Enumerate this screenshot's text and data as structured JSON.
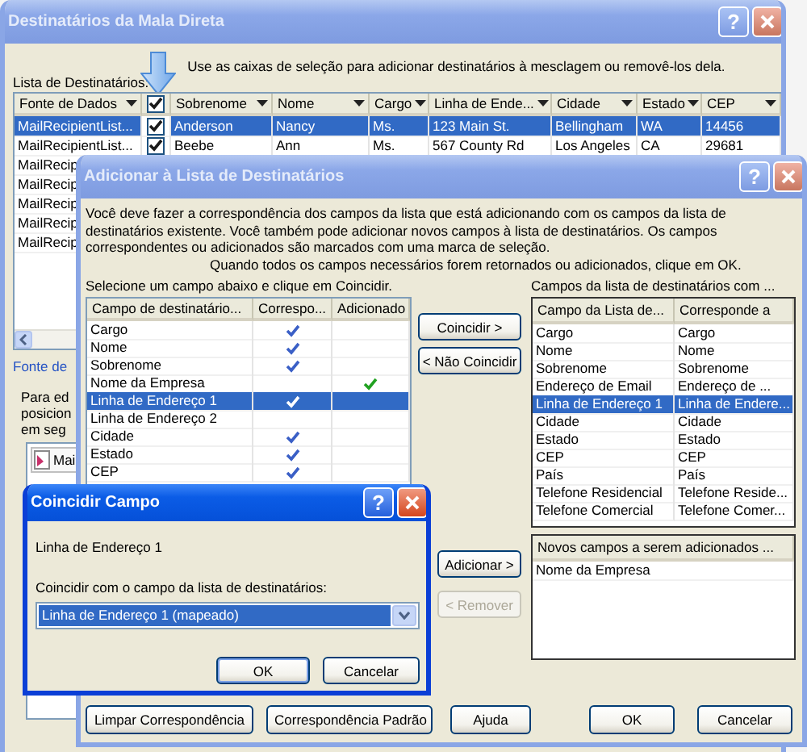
{
  "recipients_dialog": {
    "window": {
      "title": "Destinatários da Mala Direta",
      "help": "?",
      "active": false
    },
    "list_label": "Lista de Destinatários:",
    "hint": "Use as caixas de seleção para adicionar destinatários à mesclagem ou removê-los dela.",
    "table": {
      "columns": [
        "Fonte de Dados",
        "Sobrenome",
        "Nome",
        "Cargo",
        "Linha de Ende...",
        "Cidade",
        "Estado",
        "CEP"
      ],
      "header_checked": true,
      "rows": [
        {
          "source": "MailRecipientList...",
          "checked": true,
          "selected": true,
          "cells": [
            "Anderson",
            "Nancy",
            "Ms.",
            "123 Main St.",
            "Bellingham",
            "WA",
            "14456"
          ]
        },
        {
          "source": "MailRecipientList...",
          "checked": true,
          "selected": false,
          "cells": [
            "Beebe",
            "Ann",
            "Ms.",
            "567 County Rd",
            "Los Angeles",
            "CA",
            "29681"
          ]
        },
        {
          "source": "MailRecip",
          "selected": false
        },
        {
          "source": "MailRecip",
          "selected": false
        },
        {
          "source": "MailRecip",
          "selected": false
        },
        {
          "source": "MailRecip",
          "selected": false
        },
        {
          "source": "MailRecip",
          "selected": false
        }
      ]
    },
    "link": "Fonte de",
    "description_lines": [
      "Para ed",
      "posicion",
      "em seg"
    ],
    "list_item": "Mai"
  },
  "add_dialog": {
    "window": {
      "title": "Adicionar à Lista de Destinatários",
      "help": "?",
      "active": false
    },
    "intro": "Você deve fazer a correspondência dos campos da lista que está adicionando com os campos da lista de destinatários existente. Você também pode adicionar novos campos à lista de destinatários. Os campos correspondentes ou adicionados são marcados com uma marca de seleção.",
    "note": "Quando todos os campos necessários forem retornados ou adicionados, clique em OK.",
    "left_label": "Selecione um campo abaixo e clique em Coincidir.",
    "left_list": {
      "columns": [
        "Campo de destinatário...",
        "Correspo...",
        "Adicionado"
      ],
      "rows": [
        {
          "field": "Cargo",
          "matched": true,
          "added": false,
          "selected": false
        },
        {
          "field": "Nome",
          "matched": true,
          "added": false,
          "selected": false
        },
        {
          "field": "Sobrenome",
          "matched": true,
          "added": false,
          "selected": false
        },
        {
          "field": "Nome da Empresa",
          "matched": false,
          "added": true,
          "selected": false
        },
        {
          "field": "Linha de Endereço 1",
          "matched": true,
          "added": false,
          "selected": true
        },
        {
          "field": "Linha de Endereço 2",
          "matched": false,
          "added": false,
          "selected": false
        },
        {
          "field": "Cidade",
          "matched": true,
          "added": false,
          "selected": false
        },
        {
          "field": "Estado",
          "matched": true,
          "added": false,
          "selected": false
        },
        {
          "field": "CEP",
          "matched": true,
          "added": false,
          "selected": false
        }
      ]
    },
    "middle_buttons": [
      {
        "label": "Coincidir >",
        "disabled": false
      },
      {
        "label": "< Não Coincidir",
        "disabled": false
      },
      {
        "label": "Adicionar >",
        "disabled": false
      },
      {
        "label": "< Remover",
        "disabled": true
      }
    ],
    "right_label": "Campos da lista de destinatários com ...",
    "right_list": {
      "columns": [
        "Campo da Lista de...",
        "Corresponde a"
      ],
      "rows": [
        {
          "field": "Cargo",
          "match": "Cargo",
          "selected": false
        },
        {
          "field": "Nome",
          "match": "Nome",
          "selected": false
        },
        {
          "field": "Sobrenome",
          "match": "Sobrenome",
          "selected": false
        },
        {
          "field": "Endereço de Email",
          "match": "Endereço de ...",
          "selected": false
        },
        {
          "field": "Linha de Endereço 1",
          "match": "Linha de Endere...",
          "selected": true
        },
        {
          "field": "Cidade",
          "match": "Cidade",
          "selected": false
        },
        {
          "field": "Estado",
          "match": "Estado",
          "selected": false
        },
        {
          "field": "CEP",
          "match": "CEP",
          "selected": false
        },
        {
          "field": "País",
          "match": "País",
          "selected": false
        },
        {
          "field": "Telefone Residencial",
          "match": "Telefone Reside...",
          "selected": false
        },
        {
          "field": "Telefone Comercial",
          "match": "Telefone Comer...",
          "selected": false
        }
      ]
    },
    "new_fields": {
      "column": "Novos campos a serem adicionados ...",
      "rows": [
        "Nome da Empresa"
      ]
    },
    "buttons": [
      "Limpar Correspondência",
      "Correspondência Padrão",
      "Ajuda",
      "OK",
      "Cancelar"
    ]
  },
  "match_field_dialog": {
    "window": {
      "title": "Coincidir Campo",
      "help": "?",
      "active": true
    },
    "field": "Linha de Endereço 1",
    "combo_label": "Coincidir com o campo da lista de destinatários:",
    "combo_value": "Linha de Endereço 1 (mapeado)",
    "buttons": [
      "OK",
      "Cancelar"
    ]
  }
}
